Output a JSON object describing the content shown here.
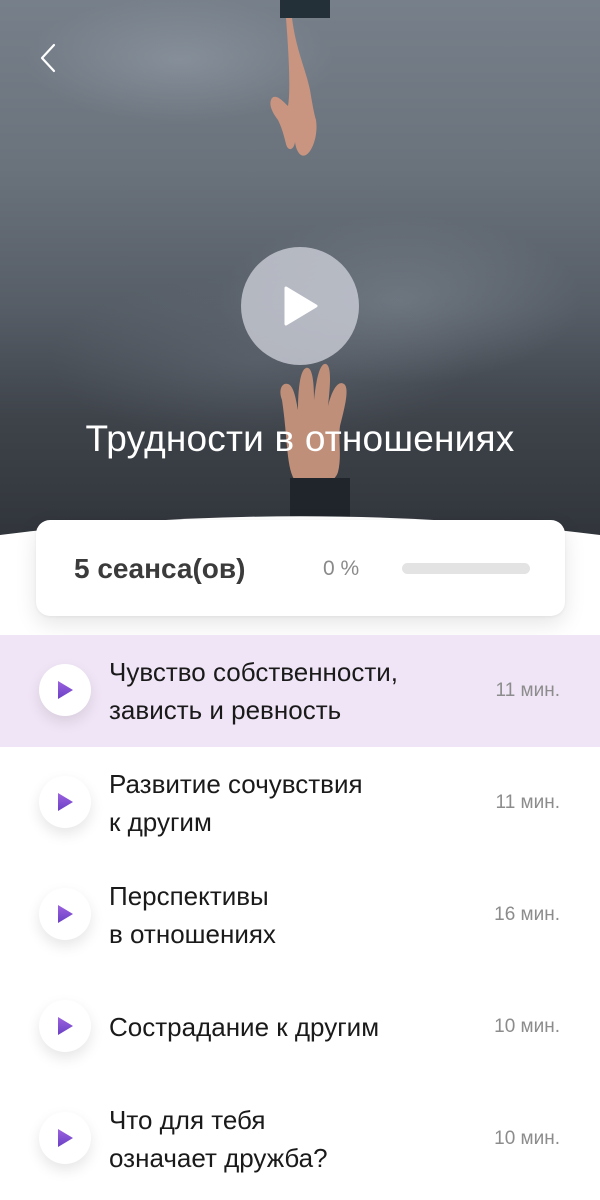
{
  "header": {
    "back_icon": "chevron-left-icon",
    "play_icon": "play-icon",
    "title": "Трудности в отношениях"
  },
  "summary": {
    "sessions_label": "5 сеанса(ов)",
    "progress_label": "0 %",
    "progress_value": 0
  },
  "colors": {
    "accent": "#8a52d6",
    "active_row": "#f0e5f6"
  },
  "sessions": [
    {
      "line1": "Чувство собственности,",
      "line2": "зависть и ревность",
      "duration": "11 мин.",
      "active": true
    },
    {
      "line1": "Развитие сочувствия",
      "line2": "к другим",
      "duration": "11 мин.",
      "active": false
    },
    {
      "line1": "Перспективы",
      "line2": "в отношениях",
      "duration": "16 мин.",
      "active": false
    },
    {
      "line1": "Сострадание к другим",
      "line2": "",
      "duration": "10 мин.",
      "active": false
    },
    {
      "line1": "Что для тебя",
      "line2": "означает дружба?",
      "duration": "10 мин.",
      "active": false
    }
  ]
}
